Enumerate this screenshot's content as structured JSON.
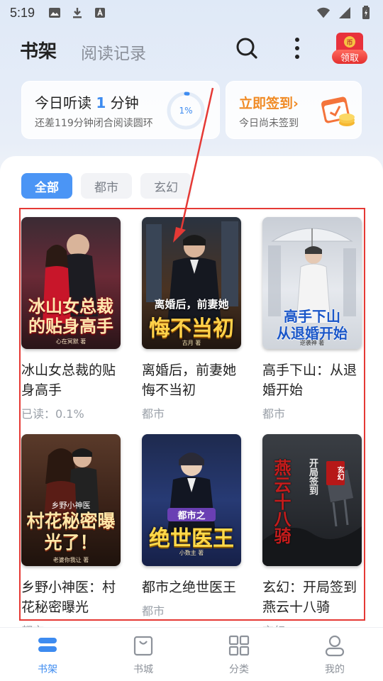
{
  "status_bar": {
    "time": "5:19"
  },
  "header": {
    "tab_active": "书架",
    "tab_inactive": "阅读记录",
    "reward_badge": "领取",
    "reward_coin": "币"
  },
  "listen_card": {
    "title_prefix": "今日听读 ",
    "minutes": "1",
    "title_suffix": " 分钟",
    "subtitle": "还差119分钟闭合阅读圆环",
    "progress_label": "1%",
    "progress": 0.01
  },
  "sign_card": {
    "title": "立即签到›",
    "subtitle": "今日尚未签到"
  },
  "filters": [
    "全部",
    "都市",
    "玄幻"
  ],
  "books": [
    {
      "title": "冰山女总裁的贴身高手",
      "meta": "已读：0.1%",
      "cover_text": "冰山女总裁的贴身高手",
      "cover_author": "心在冥默 著"
    },
    {
      "title": "离婚后，前妻她悔不当初",
      "meta": "都市",
      "cover_text_top": "离婚后，前妻她",
      "cover_text": "悔不当初",
      "cover_author": "古月 著"
    },
    {
      "title": "高手下山：从退婚开始",
      "meta": "都市",
      "cover_text_top": "高手下山",
      "cover_text": "从退婚开始",
      "cover_author": "逆袭神 著"
    },
    {
      "title": "乡野小神医：村花秘密曝光",
      "meta": "都市",
      "cover_text_top": "乡野小神医",
      "cover_text": "村花秘密曝光了！",
      "cover_author": "老婆你我让 著"
    },
    {
      "title": "都市之绝世医王",
      "meta": "都市",
      "cover_text_top": "都市之",
      "cover_text": "绝世医王",
      "cover_author": "小数主 著"
    },
    {
      "title": "玄幻：开局签到燕云十八骑",
      "meta": "玄幻",
      "cover_text_top": "开局签到",
      "cover_text": "燕云十八骑",
      "cover_author": "玄幻"
    }
  ],
  "bottom_nav": [
    "书架",
    "书城",
    "分类",
    "我的"
  ],
  "colors": {
    "accent": "#3d8bf0",
    "sign": "#f08a24",
    "highlight": "#e53935"
  }
}
